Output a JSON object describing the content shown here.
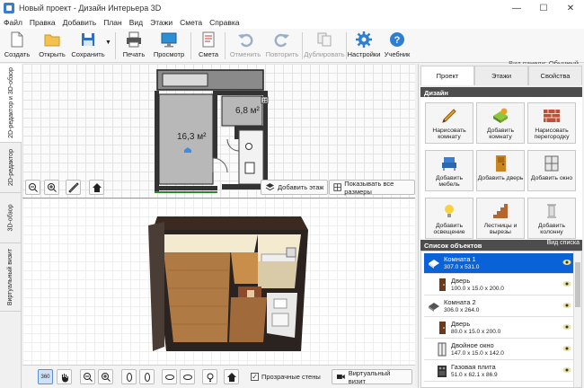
{
  "window": {
    "title": "Новый проект - Дизайн Интерьера 3D",
    "minimize": "—",
    "maximize": "☐",
    "close": "✕"
  },
  "menu": [
    "Файл",
    "Правка",
    "Добавить",
    "План",
    "Вид",
    "Этажи",
    "Смета",
    "Справка"
  ],
  "toolbar": {
    "create": "Создать",
    "open": "Открыть",
    "save": "Сохранить",
    "print": "Печать",
    "preview": "Просмотр",
    "estimate": "Смета",
    "undo": "Отменить",
    "redo": "Повторить",
    "duplicate": "Дублировать",
    "settings": "Настройки",
    "tutorial": "Учебник"
  },
  "view_panel": {
    "label": "Вид панели:",
    "value": "Обычный"
  },
  "left_tabs": [
    "2D-редактор и 3D-обзор",
    "2D-редактор",
    "3D-обзор",
    "Виртуальный визит"
  ],
  "plan": {
    "room1_area": "16,3 м²",
    "room2_area": "6,8 м²",
    "add_floor": "Добавить этаж",
    "show_sizes": "Показывать все размеры"
  },
  "bottom": {
    "transparent_walls": "Прозрачные стены",
    "virtual_visit": "Виртуальный визит",
    "rotate_label": "360"
  },
  "right_tabs": [
    "Проект",
    "Этажи",
    "Свойства"
  ],
  "design": {
    "header": "Дизайн",
    "buttons": [
      "Нарисовать комнату",
      "Добавить комнату",
      "Нарисовать перегородку",
      "Добавить мебель",
      "Добавить дверь",
      "Добавить окно",
      "Добавить освещение",
      "Лестницы и вырезы",
      "Добавить колонну"
    ]
  },
  "objects": {
    "header": "Список объектов",
    "view_list": "Вид списка",
    "items": [
      {
        "name": "Комната 1",
        "dims": "307.0 x 531.0"
      },
      {
        "name": "Дверь",
        "dims": "100.0 x 15.0 x 200.0"
      },
      {
        "name": "Комната 2",
        "dims": "306.0 x 264.0"
      },
      {
        "name": "Дверь",
        "dims": "80.0 x 15.0 x 200.0"
      },
      {
        "name": "Двойное окно",
        "dims": "147.0 x 15.0 x 142.0"
      },
      {
        "name": "Газовая плита",
        "dims": "51.0 x 62.1 x 86.9"
      }
    ]
  },
  "colors": {
    "accent": "#0a62d8",
    "section_header": "#4d4d4d",
    "floor": "#b07a45",
    "wall": "#f3ead0"
  }
}
